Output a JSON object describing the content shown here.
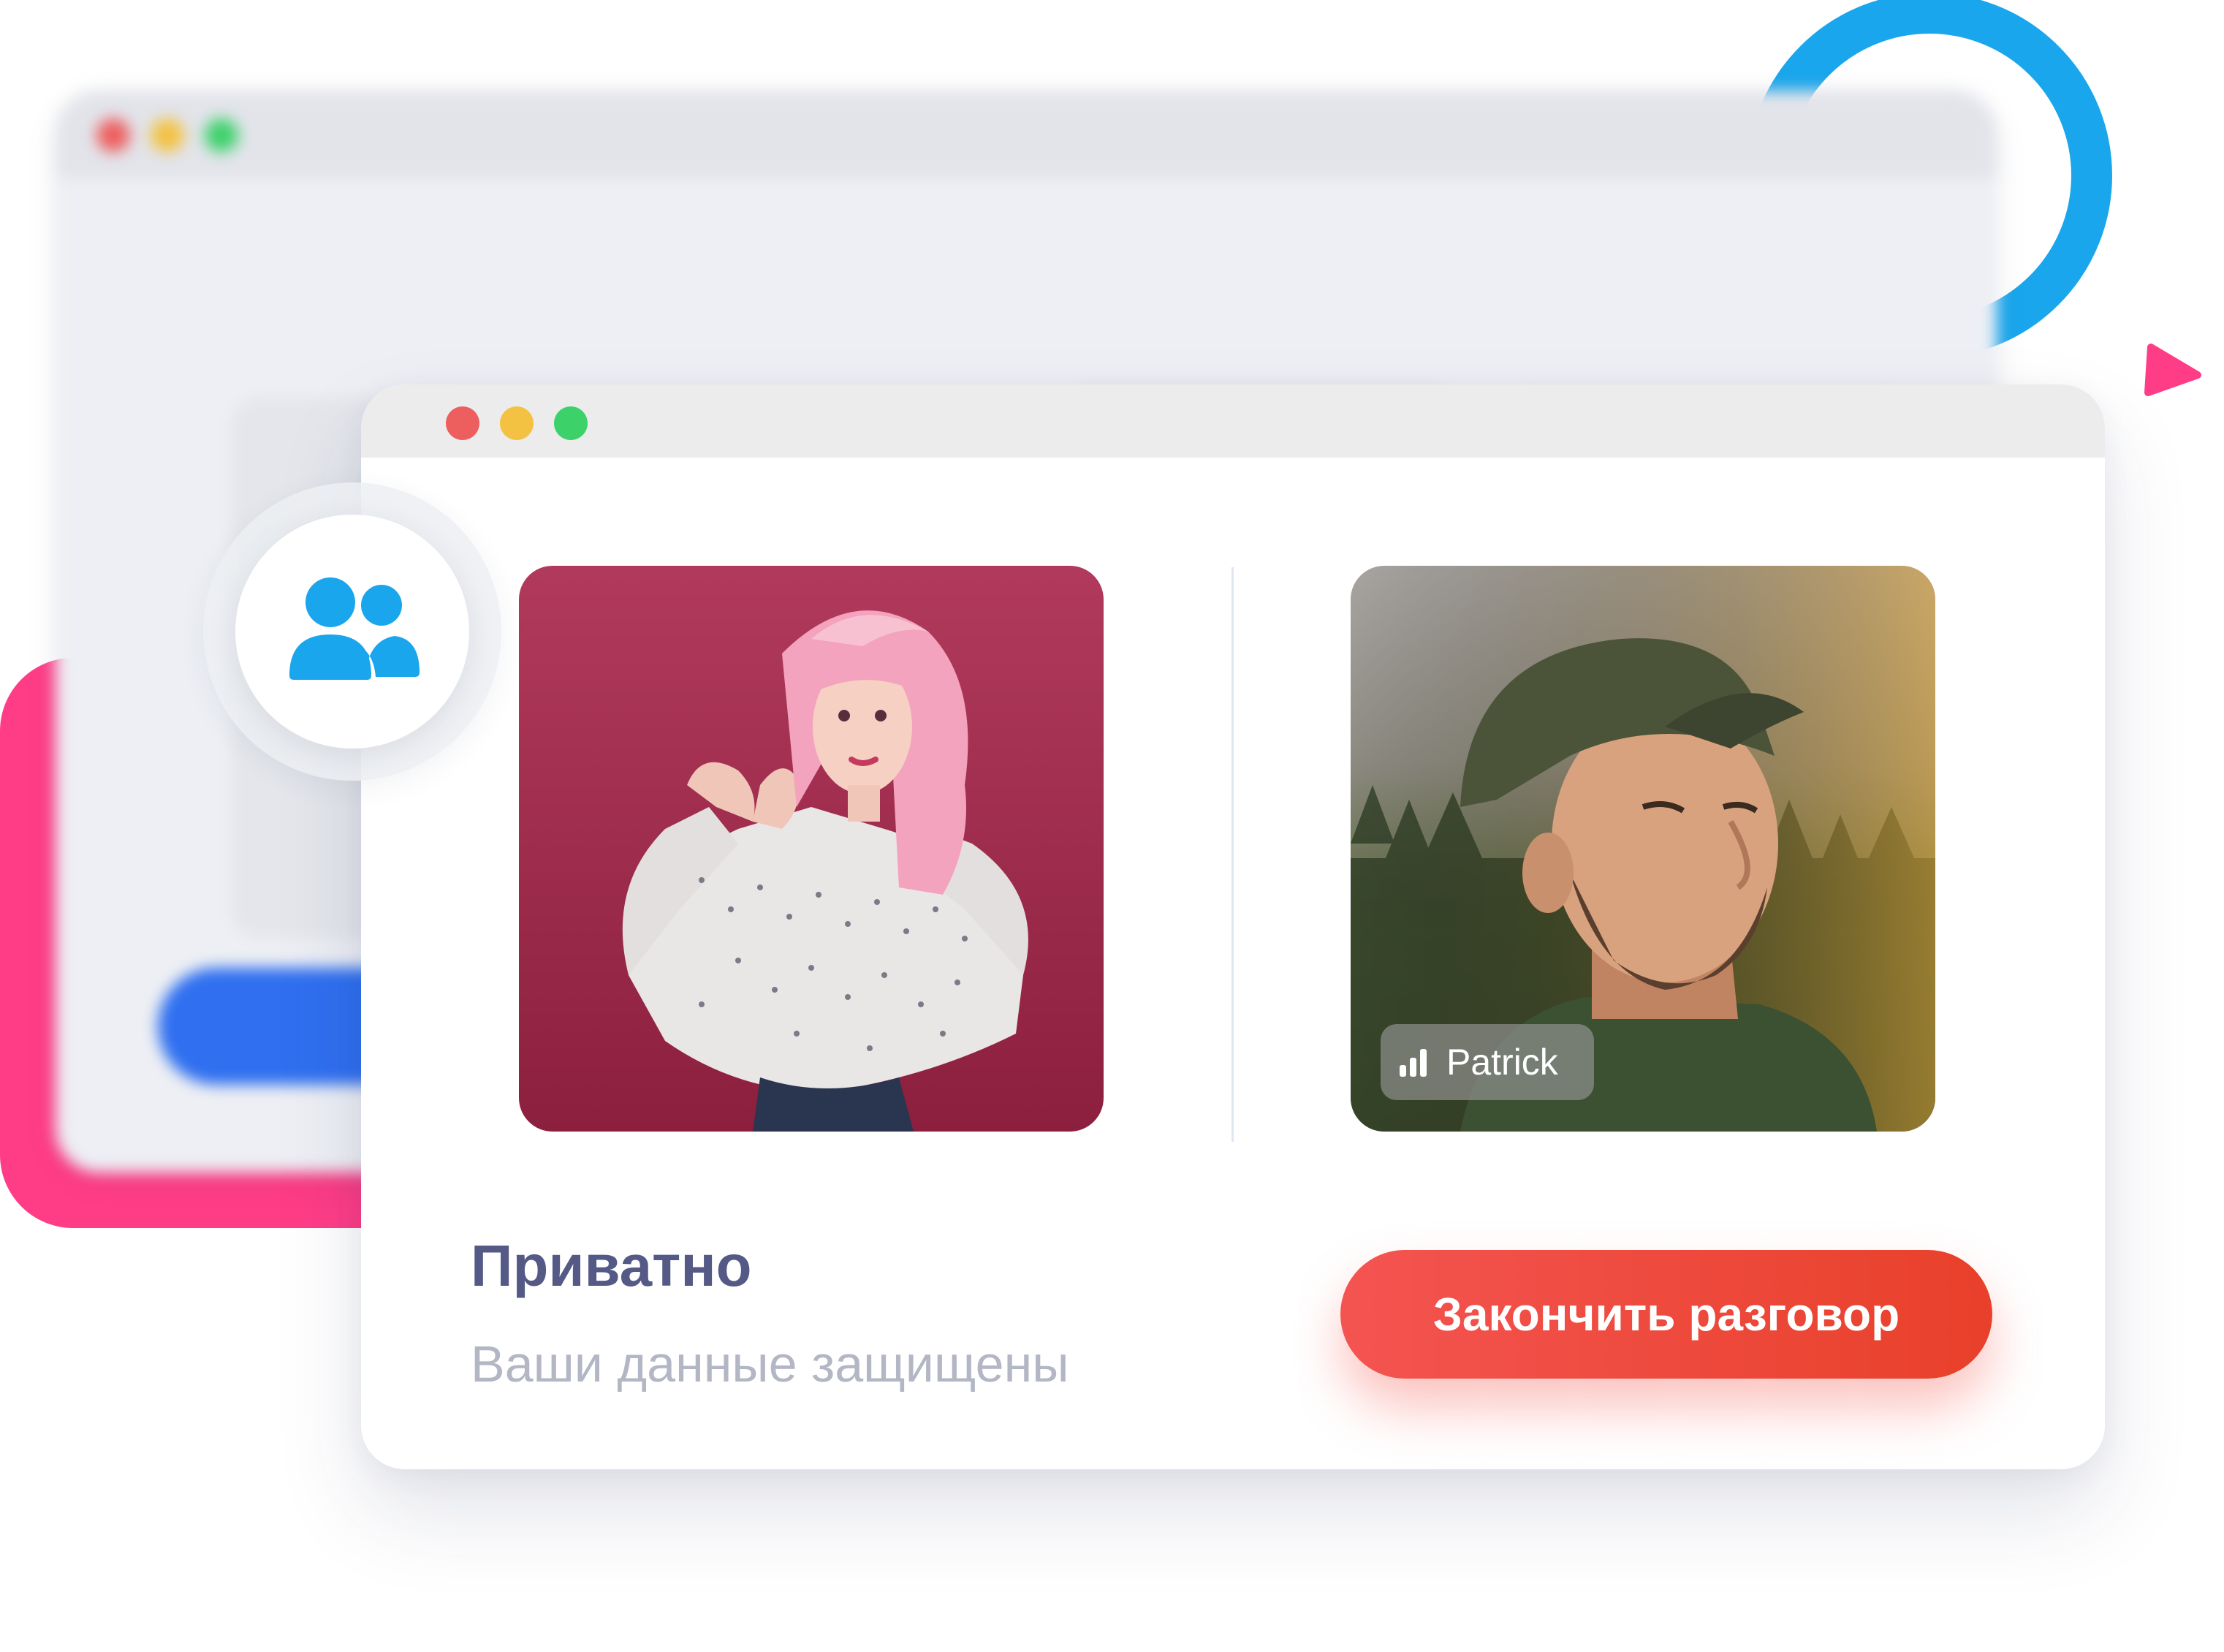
{
  "main": {
    "title": "Приватно",
    "subtitle": "Ваши данные защищены",
    "end_call_label": "Закончить разговор",
    "participant_name": "Patrick"
  },
  "icons": {
    "users": "users-icon",
    "signal": "signal-bars-icon"
  },
  "colors": {
    "accent_blue": "#1aa6ec",
    "accent_pink": "#ff3d87",
    "button_red": "#e8402a",
    "title": "#545a85",
    "subtitle": "#b3b6c4",
    "traffic_red": "#ed5e5e",
    "traffic_yellow": "#f3c242",
    "traffic_green": "#3dd16a"
  }
}
